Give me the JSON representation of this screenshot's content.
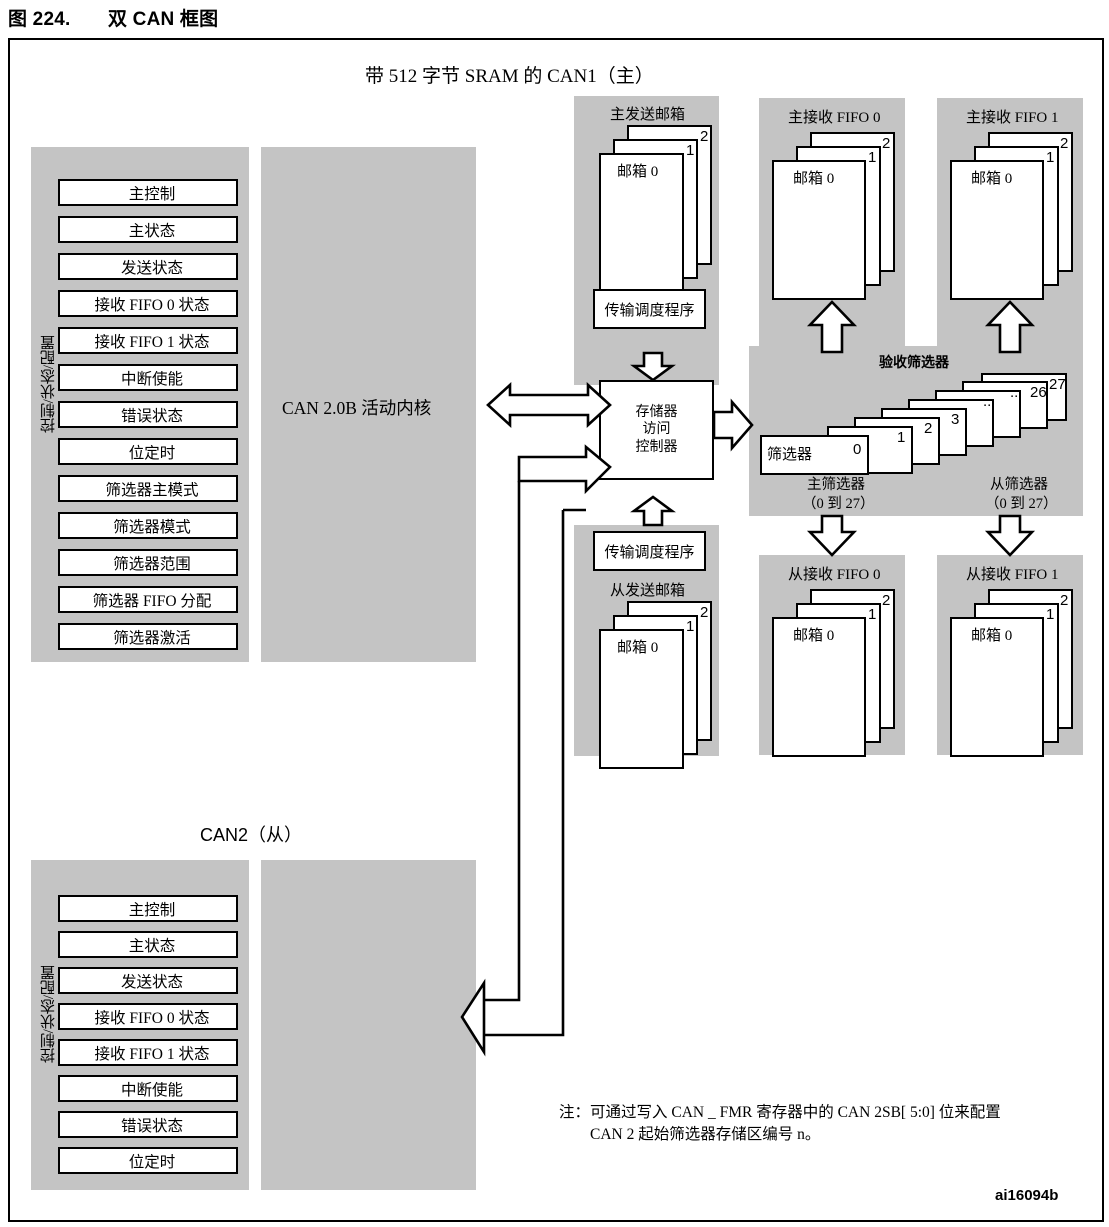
{
  "figure": {
    "number": "图 224.",
    "title": "双 CAN 框图",
    "code": "ai16094b"
  },
  "can1": {
    "title": "带 512 字节 SRAM 的 CAN1（主）",
    "side_label": "控制/状态/配置",
    "core_label": "CAN 2.0B 活动内核",
    "registers": [
      "主控制",
      "主状态",
      "发送状态",
      "接收 FIFO 0 状态",
      "接收 FIFO 1 状态",
      "中断使能",
      "错误状态",
      "位定时",
      "筛选器主模式",
      "筛选器模式",
      "筛选器范围",
      "筛选器 FIFO 分配",
      "筛选器激活"
    ]
  },
  "memory_controller": {
    "line1": "存储器",
    "line2": "访问",
    "line3": "控制器"
  },
  "master_tx": {
    "caption": "主发送邮箱",
    "mailbox_label": "邮箱 0",
    "stack_numbers": [
      "1",
      "2"
    ],
    "scheduler": "传输调度程序"
  },
  "slave_tx": {
    "caption": "从发送邮箱",
    "mailbox_label": "邮箱 0",
    "stack_numbers": [
      "1",
      "2"
    ],
    "scheduler": "传输调度程序"
  },
  "master_fifos": [
    {
      "caption": "主接收 FIFO 0",
      "mailbox_label": "邮箱 0",
      "stack_numbers": [
        "1",
        "2"
      ]
    },
    {
      "caption": "主接收 FIFO 1",
      "mailbox_label": "邮箱 0",
      "stack_numbers": [
        "1",
        "2"
      ]
    }
  ],
  "slave_fifos": [
    {
      "caption": "从接收 FIFO 0",
      "mailbox_label": "邮箱 0",
      "stack_numbers": [
        "1",
        "2"
      ]
    },
    {
      "caption": "从接收 FIFO 1",
      "mailbox_label": "邮箱 0",
      "stack_numbers": [
        "1",
        "2"
      ]
    }
  ],
  "acceptance_filters": {
    "title": "验收筛选器",
    "first_label": "筛选器",
    "numbers": [
      "0",
      "1",
      "2",
      "3",
      "..",
      "..",
      "26",
      "27"
    ],
    "master_caption_line1": "主筛选器",
    "master_caption_line2": "（0 到 27）",
    "slave_caption_line1": "从筛选器",
    "slave_caption_line2": "（0 到 27）"
  },
  "can2": {
    "title": "CAN2（从）",
    "side_label": "控制/状态/配置",
    "registers": [
      "主控制",
      "主状态",
      "发送状态",
      "接收 FIFO 0 状态",
      "接收 FIFO 1 状态",
      "中断使能",
      "错误状态",
      "位定时"
    ]
  },
  "note": {
    "line1": "注：可通过写入 CAN _ FMR 寄存器中的 CAN 2SB[ 5:0] 位来配置",
    "line2": "CAN 2 起始筛选器存储区编号 n。"
  },
  "colors": {
    "panel_gray": "#c4c4c4",
    "stroke": "#000000",
    "background": "#ffffff"
  }
}
